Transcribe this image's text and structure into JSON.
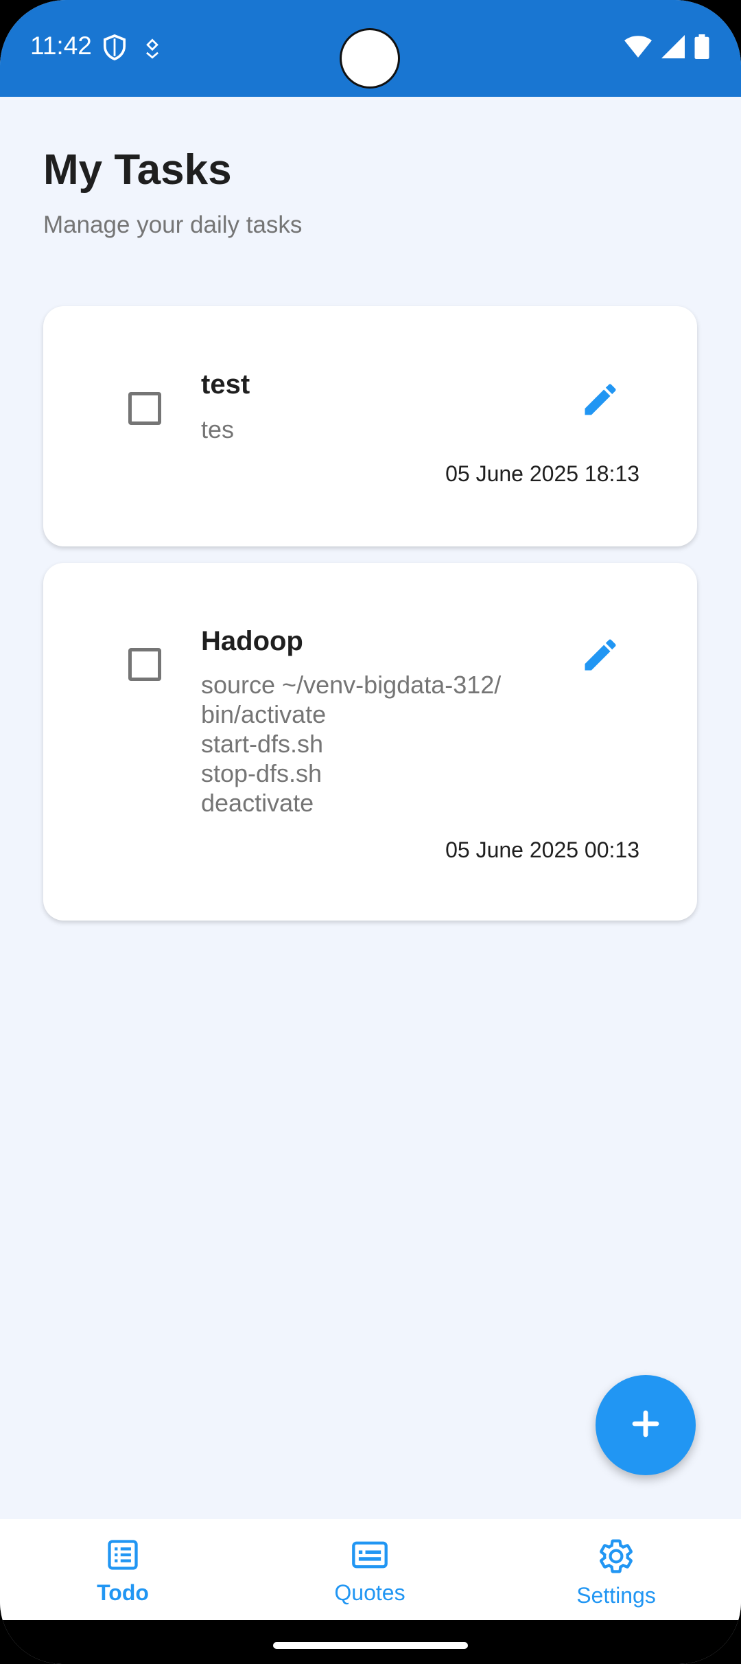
{
  "status_bar": {
    "time": "11:42",
    "left_icons": [
      "shield-icon",
      "location-icon"
    ],
    "right_icons": [
      "wifi-icon",
      "signal-icon",
      "battery-icon"
    ],
    "color": "#1976D2"
  },
  "header": {
    "title": "My Tasks",
    "subtitle": "Manage your daily tasks"
  },
  "tasks": [
    {
      "title": "test",
      "description": "tes",
      "date": "05 June 2025 18:13",
      "checked": false
    },
    {
      "title": "Hadoop",
      "description": "source ~/venv-bigdata-312/\nbin/activate\nstart-dfs.sh\nstop-dfs.sh\ndeactivate",
      "date": "05 June 2025 00:13",
      "checked": false
    }
  ],
  "fab": {
    "icon": "plus-icon"
  },
  "nav": {
    "items": [
      {
        "label": "Todo",
        "icon": "list-icon",
        "active": true
      },
      {
        "label": "Quotes",
        "icon": "quote-card-icon",
        "active": false
      },
      {
        "label": "Settings",
        "icon": "gear-icon",
        "active": false
      }
    ]
  },
  "colors": {
    "accent": "#2196F3",
    "background": "#F1F5FD",
    "status_bar": "#1976D2"
  }
}
